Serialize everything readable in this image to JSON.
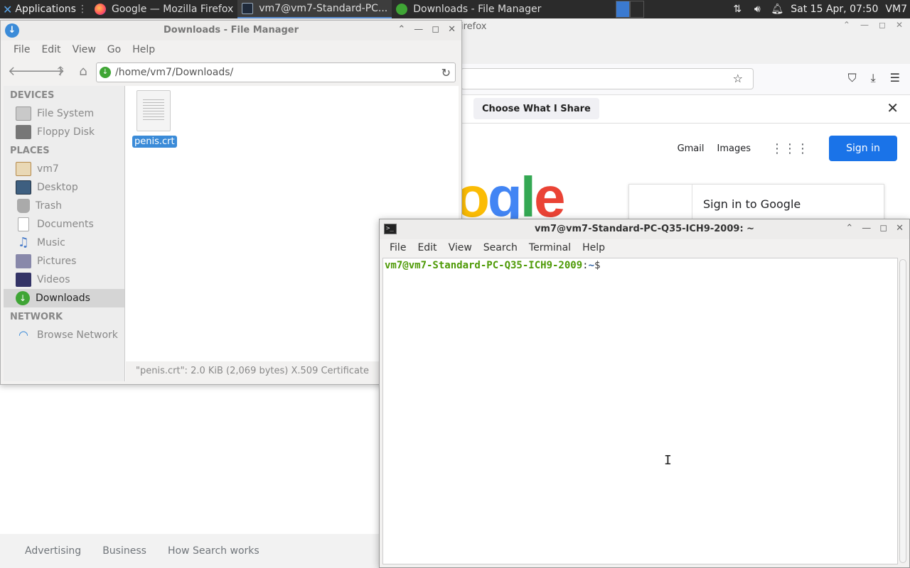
{
  "panel": {
    "apps_label": "Applications",
    "tasks": [
      {
        "label": "Google — Mozilla Firefox",
        "icon": "firefox-icon"
      },
      {
        "label": "vm7@vm7-Standard-PC...",
        "icon": "terminal-icon"
      },
      {
        "label": "Downloads - File Manager",
        "icon": "downloads-icon"
      }
    ],
    "clock": "Sat 15 Apr, 07:50",
    "user": "VM7",
    "accent": "#3b7ad0"
  },
  "firefox": {
    "title_fragment": "irefox",
    "notification_button": "Choose What I Share",
    "header_links": [
      "Gmail",
      "Images"
    ],
    "signin_label": "Sign in",
    "logo_text": "ogle",
    "card_title": "Sign in to Google",
    "footer_links": [
      "Advertising",
      "Business",
      "How Search works"
    ],
    "signin_color": "#1a73e8"
  },
  "file_manager": {
    "title": "Downloads - File Manager",
    "menu": [
      "File",
      "Edit",
      "View",
      "Go",
      "Help"
    ],
    "location": "/home/vm7/Downloads/",
    "sections": {
      "devices_label": "DEVICES",
      "places_label": "PLACES",
      "network_label": "NETWORK"
    },
    "devices": [
      {
        "label": "File System",
        "icon": "drive-icon"
      },
      {
        "label": "Floppy Disk",
        "icon": "floppy-icon"
      }
    ],
    "places": [
      {
        "label": "vm7",
        "icon": "home-icon"
      },
      {
        "label": "Desktop",
        "icon": "desktop-icon"
      },
      {
        "label": "Trash",
        "icon": "trash-icon"
      },
      {
        "label": "Documents",
        "icon": "documents-icon"
      },
      {
        "label": "Music",
        "icon": "music-icon"
      },
      {
        "label": "Pictures",
        "icon": "pictures-icon"
      },
      {
        "label": "Videos",
        "icon": "videos-icon"
      },
      {
        "label": "Downloads",
        "icon": "downloads-icon",
        "selected": true
      }
    ],
    "network": [
      {
        "label": "Browse Network",
        "icon": "network-icon"
      }
    ],
    "files": [
      {
        "name": "penis.crt",
        "selected": true
      }
    ],
    "status": "\"penis.crt\": 2.0 KiB (2,069 bytes) X.509 Certificate"
  },
  "terminal": {
    "title": "vm7@vm7-Standard-PC-Q35-ICH9-2009: ~",
    "menu": [
      "File",
      "Edit",
      "View",
      "Search",
      "Terminal",
      "Help"
    ],
    "prompt_user": "vm7@vm7-Standard-PC-Q35-ICH9-2009",
    "prompt_sep": ":",
    "prompt_path": "~",
    "prompt_symbol": "$"
  }
}
